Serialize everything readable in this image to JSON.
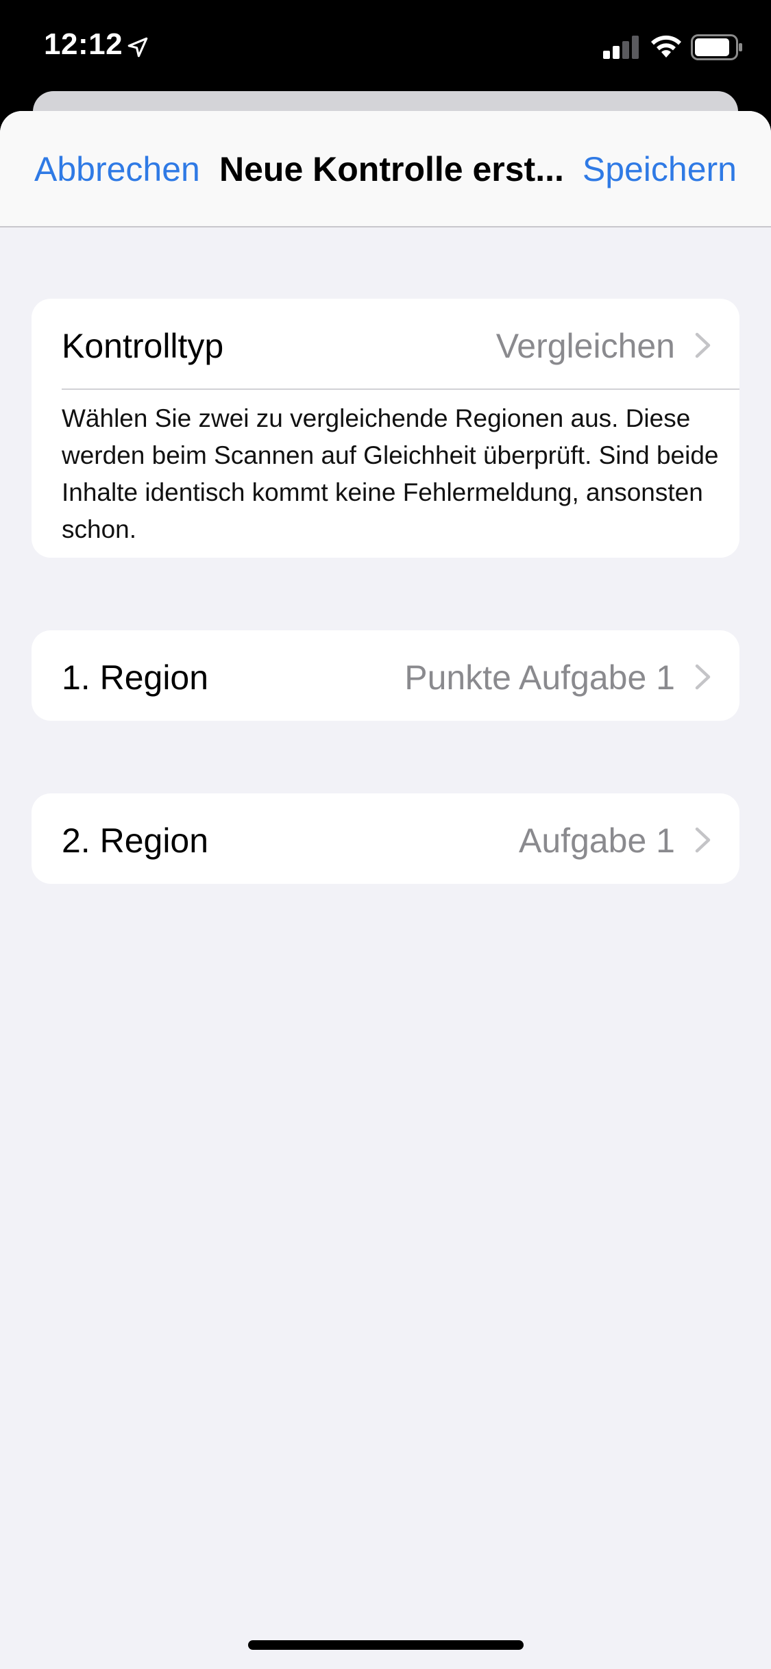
{
  "status_bar": {
    "time": "12:12",
    "location_icon": "location-arrow-icon",
    "signal_icon": "cellular-signal-icon",
    "wifi_icon": "wifi-icon",
    "battery_icon": "battery-icon"
  },
  "nav": {
    "cancel_label": "Abbrechen",
    "title": "Neue Kontrolle erst...",
    "save_label": "Speichern"
  },
  "control_type": {
    "label": "Kontrolltyp",
    "value": "Vergleichen",
    "description": "Wählen Sie zwei zu vergleichende Regionen aus. Diese werden beim Scannen auf Gleichheit überprüft. Sind beide Inhalte identisch kommt keine Fehlermeldung, ansonsten schon."
  },
  "region_1": {
    "label": "1. Region",
    "value": "Punkte Aufgabe 1"
  },
  "region_2": {
    "label": "2. Region",
    "value": "Aufgabe 1"
  },
  "colors": {
    "accent": "#2f7ae5",
    "background": "#f2f2f7",
    "secondary_text": "#8a8a8e"
  }
}
